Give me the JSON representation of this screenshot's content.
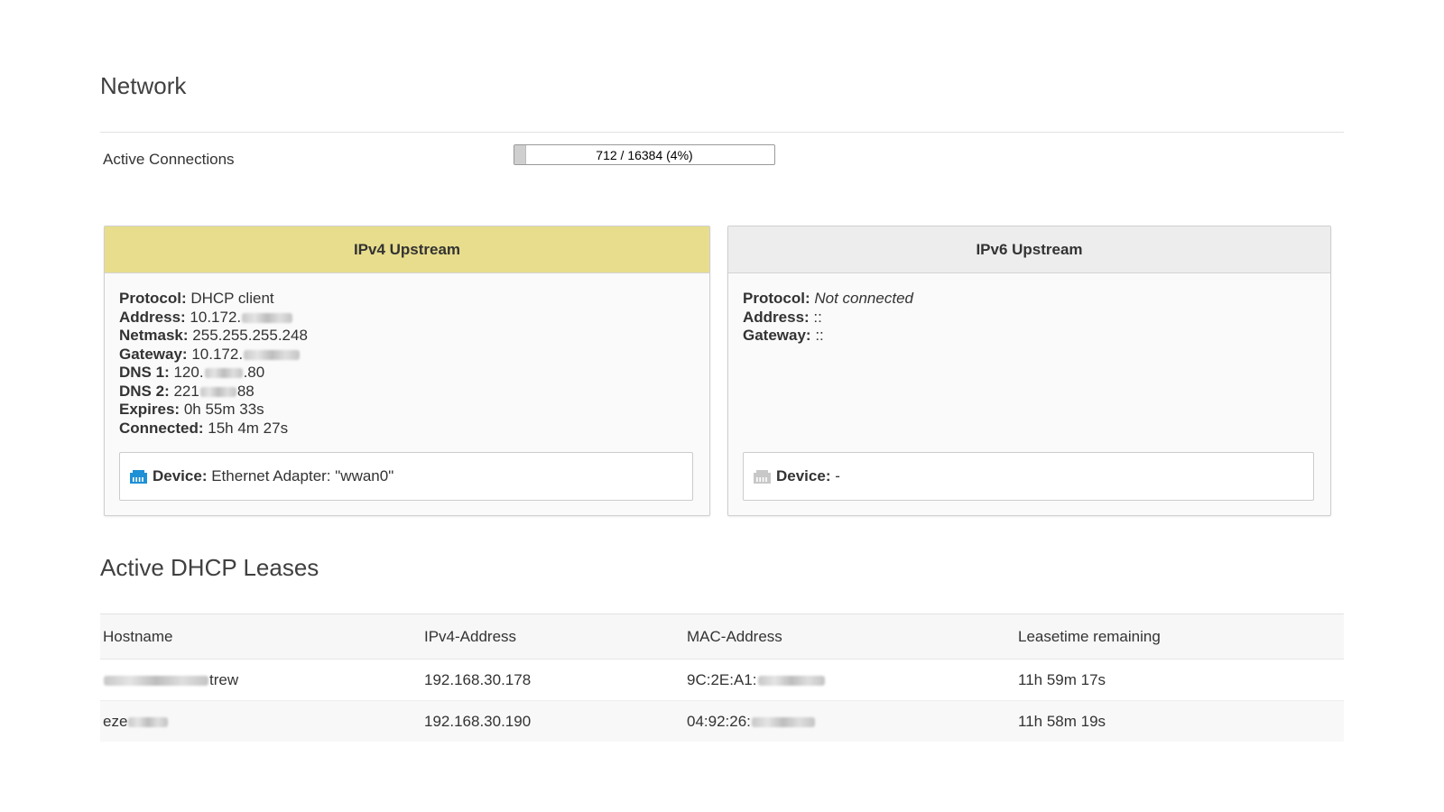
{
  "network": {
    "title": "Network",
    "active_connections": {
      "label": "Active Connections",
      "text": "712 / 16384 (4%)",
      "used": 712,
      "max": 16384,
      "fraction": 0.04
    }
  },
  "ipv4": {
    "title": "IPv4 Upstream",
    "header_color": "#e8dd8c",
    "protocol_label": "Protocol:",
    "protocol": "DHCP client",
    "address_label": "Address:",
    "address": "10.172.",
    "netmask_label": "Netmask:",
    "netmask": "255.255.255.248",
    "gateway_label": "Gateway:",
    "gateway": "10.172.",
    "dns1_label": "DNS 1:",
    "dns1_prefix": "120.",
    "dns1_suffix": ".80",
    "dns2_label": "DNS 2:",
    "dns2_prefix": "221",
    "dns2_suffix": "88",
    "expires_label": "Expires:",
    "expires": "0h 55m 33s",
    "connected_label": "Connected:",
    "connected": "15h 4m 27s",
    "device_label": "Device:",
    "device": "Ethernet Adapter: \"wwan0\"",
    "device_icon": "ethernet-port-icon",
    "device_icon_color": "#1e90d6"
  },
  "ipv6": {
    "title": "IPv6 Upstream",
    "header_color": "#ededed",
    "protocol_label": "Protocol:",
    "protocol": "Not connected",
    "address_label": "Address:",
    "address": "::",
    "gateway_label": "Gateway:",
    "gateway": "::",
    "device_label": "Device:",
    "device": "-",
    "device_icon": "ethernet-port-icon",
    "device_icon_color": "#c8c8c8"
  },
  "leases": {
    "title": "Active DHCP Leases",
    "columns": [
      "Hostname",
      "IPv4-Address",
      "MAC-Address",
      "Leasetime remaining"
    ],
    "rows": [
      {
        "hostname": "trew",
        "ipv4": "192.168.30.178",
        "mac": "9C:2E:A1:",
        "leasetime": "11h 59m 17s"
      },
      {
        "hostname": "eze",
        "ipv4": "192.168.30.190",
        "mac": "04:92:26:",
        "leasetime": "11h 58m 19s"
      }
    ]
  }
}
